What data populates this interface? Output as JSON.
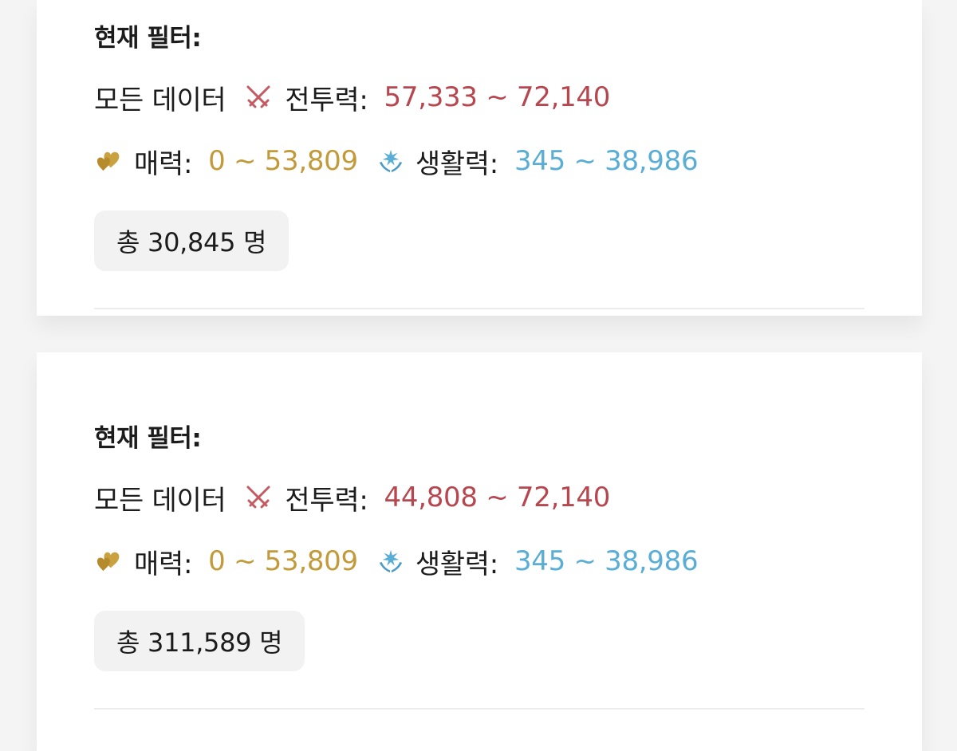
{
  "cards": [
    {
      "title": "현재 필터:",
      "all_data_label": "모든 데이터",
      "combat": {
        "icon": "crossed-swords-icon",
        "label": "전투력:",
        "range": "57,333 ~ 72,140"
      },
      "charm": {
        "icon": "hearts-icon",
        "label": "매력:",
        "range": "0 ~ 53,809"
      },
      "vitality": {
        "icon": "sparkle-hands-icon",
        "label": "생활력:",
        "range": "345 ~ 38,986"
      },
      "total": "총 30,845 명"
    },
    {
      "title": "현재 필터:",
      "all_data_label": "모든 데이터",
      "combat": {
        "icon": "crossed-swords-icon",
        "label": "전투력:",
        "range": "44,808 ~ 72,140"
      },
      "charm": {
        "icon": "hearts-icon",
        "label": "매력:",
        "range": "0 ~ 53,809"
      },
      "vitality": {
        "icon": "sparkle-hands-icon",
        "label": "생활력:",
        "range": "345 ~ 38,986"
      },
      "total": "총 311,589 명"
    }
  ],
  "colors": {
    "combat": "#b7474f",
    "charm": "#c29a39",
    "vitality": "#5aaed6",
    "badge_bg": "#f2f2f2"
  }
}
